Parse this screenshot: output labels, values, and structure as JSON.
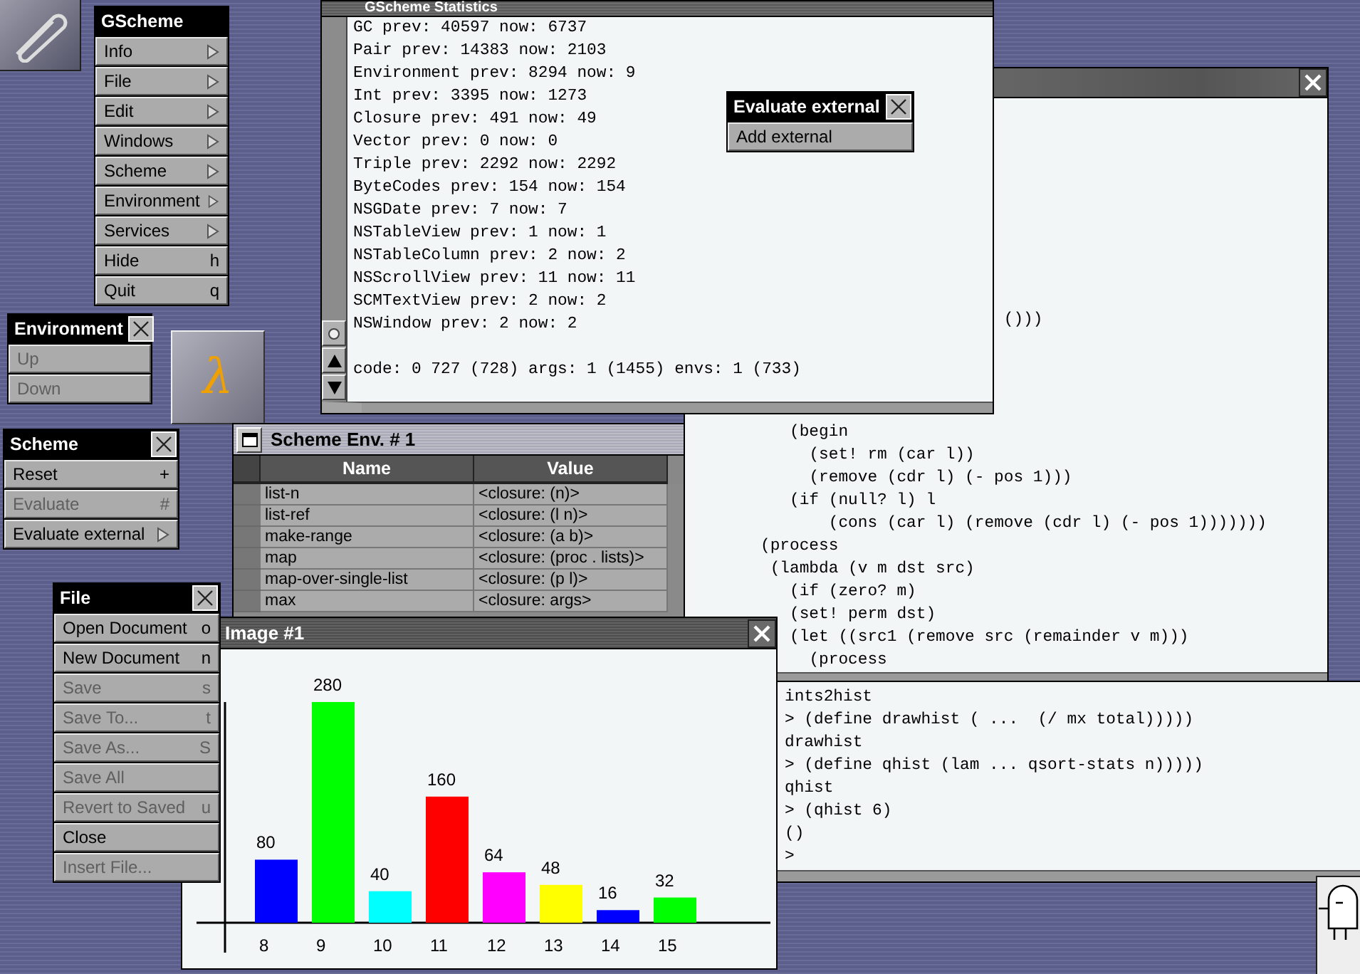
{
  "main_menu": {
    "title": "GScheme",
    "closable": false,
    "items": [
      {
        "label": "Info",
        "kind": "submenu",
        "disabled": false
      },
      {
        "label": "File",
        "kind": "submenu",
        "disabled": false
      },
      {
        "label": "Edit",
        "kind": "submenu",
        "disabled": false
      },
      {
        "label": "Windows",
        "kind": "submenu",
        "disabled": false
      },
      {
        "label": "Scheme",
        "kind": "submenu",
        "disabled": false
      },
      {
        "label": "Environment",
        "kind": "submenu",
        "disabled": false
      },
      {
        "label": "Services",
        "kind": "submenu",
        "disabled": false
      },
      {
        "label": "Hide",
        "kind": "shortcut",
        "key": "h",
        "disabled": false
      },
      {
        "label": "Quit",
        "kind": "shortcut",
        "key": "q",
        "disabled": false
      }
    ]
  },
  "environment_menu": {
    "title": "Environment",
    "closable": true,
    "items": [
      {
        "label": "Up",
        "disabled": true
      },
      {
        "label": "Down",
        "disabled": true
      }
    ]
  },
  "app_icon": {
    "glyph": "λ"
  },
  "scheme_menu": {
    "title": "Scheme",
    "closable": true,
    "items": [
      {
        "label": "Reset",
        "kind": "shortcut",
        "key": "+",
        "disabled": false
      },
      {
        "label": "Evaluate",
        "kind": "shortcut",
        "key": "#",
        "disabled": true
      },
      {
        "label": "Evaluate external",
        "kind": "submenu",
        "disabled": false
      }
    ]
  },
  "file_menu": {
    "title": "File",
    "closable": true,
    "items": [
      {
        "label": "Open Document",
        "kind": "shortcut",
        "key": "o",
        "disabled": false
      },
      {
        "label": "New Document",
        "kind": "shortcut",
        "key": "n",
        "disabled": false
      },
      {
        "label": "Save",
        "kind": "shortcut",
        "key": "s",
        "disabled": true
      },
      {
        "label": "Save To...",
        "kind": "shortcut",
        "key": "t",
        "disabled": true
      },
      {
        "label": "Save As...",
        "kind": "shortcut",
        "key": "S",
        "disabled": true
      },
      {
        "label": "Save All",
        "kind": "plain",
        "disabled": true
      },
      {
        "label": "Revert to Saved",
        "kind": "shortcut",
        "key": "u",
        "disabled": true
      },
      {
        "label": "Close",
        "kind": "plain",
        "disabled": false
      },
      {
        "label": "Insert File...",
        "kind": "plain",
        "disabled": true
      }
    ]
  },
  "code_window": {
    "top_lines": [
      "                         ()))"
    ],
    "lines": [
      "   (begin",
      "     (set! rm (car l))",
      "     (remove (cdr l) (- pos 1)))",
      "   (if (null? l) l",
      "       (cons (car l) (remove (cdr l) (- pos 1)))))))",
      "(process",
      " (lambda (v m dst src)",
      "   (if (zero? m)",
      "   (set! perm dst)",
      "   (let ((src1 (remove src (remainder v m)))",
      "     (process"
    ]
  },
  "transcript_window": {
    "lines": [
      "ints2hist",
      "> (define drawhist ( ...  (/ mx total)))))",
      "drawhist",
      "> (define qhist (lam ... qsort-stats n)))))",
      "qhist",
      "> (qhist 6)",
      "()",
      ">"
    ]
  },
  "statistics_window": {
    "title": "GScheme Statistics",
    "lines": [
      "GC prev: 40597 now: 6737",
      "Pair prev: 14383 now: 2103",
      "Environment prev: 8294 now: 9",
      "Int prev: 3395 now: 1273",
      "Closure prev: 491 now: 49",
      "Vector prev: 0 now: 0",
      "Triple prev: 2292 now: 2292",
      "ByteCodes prev: 154 now: 154",
      "NSGDate prev: 7 now: 7",
      "NSTableView prev: 1 now: 1",
      "NSTableColumn prev: 2 now: 2",
      "NSScrollView prev: 11 now: 11",
      "SCMTextView prev: 2 now: 2",
      "NSWindow prev: 2 now: 2"
    ],
    "summary": "code: 0 727 (728) args: 1 (1455) envs: 1 (733)"
  },
  "evaluate_external_menu": {
    "title": "Evaluate external",
    "closable": true,
    "items": [
      {
        "label": "Add external",
        "disabled": false
      }
    ]
  },
  "environment_window": {
    "title": "Scheme Env. # 1",
    "columns": [
      "Name",
      "Value"
    ],
    "rows": [
      [
        "list-n",
        "<closure: (n)>"
      ],
      [
        "list-ref",
        "<closure: (l n)>"
      ],
      [
        "make-range",
        "<closure: (a b)>"
      ],
      [
        "map",
        "<closure: (proc . lists)>"
      ],
      [
        "map-over-single-list",
        "<closure: (p l)>"
      ],
      [
        "max",
        "<closure: args>"
      ]
    ]
  },
  "image_window": {
    "title": "Image #1",
    "chart_data": {
      "type": "bar",
      "categories": [
        "8",
        "9",
        "10",
        "11",
        "12",
        "13",
        "14",
        "15"
      ],
      "values": [
        80,
        280,
        40,
        160,
        64,
        48,
        16,
        32
      ],
      "colors": [
        "#0000ff",
        "#00ff00",
        "#00ffff",
        "#ff0000",
        "#ff00ff",
        "#ffff00",
        "#0000ff",
        "#00ff00"
      ],
      "data_labels": true
    }
  }
}
